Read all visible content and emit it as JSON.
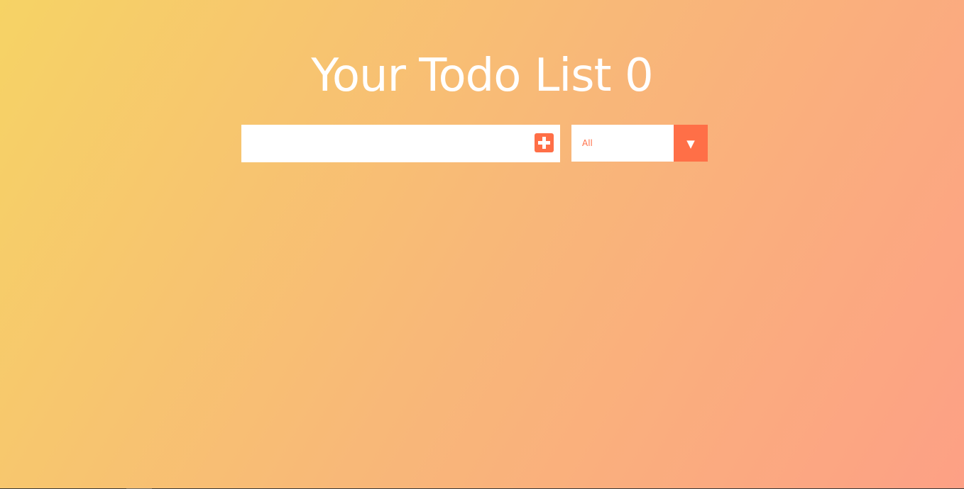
{
  "header": {
    "title": "Your Todo List 0"
  },
  "form": {
    "input_value": "",
    "input_placeholder": "",
    "add_button_icon": "plus-square-icon",
    "filter": {
      "selected": "All",
      "arrow_glyph": "▼"
    }
  },
  "colors": {
    "accent": "#ff6f47",
    "gradient_start": "#f6d365",
    "gradient_end": "#fda085",
    "title_text": "#ffffff"
  }
}
